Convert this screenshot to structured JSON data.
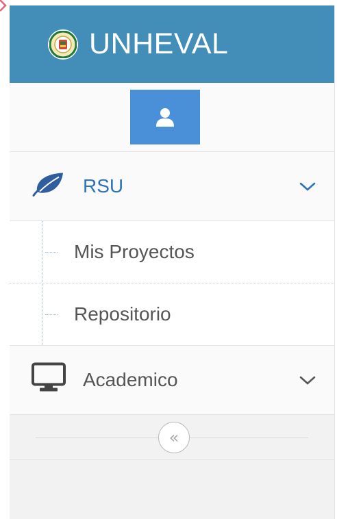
{
  "brand": {
    "title": "UNHEVAL",
    "bg_color": "#438eb9"
  },
  "shortcuts": {
    "user_icon": "user-icon",
    "button_color": "#4a90d9"
  },
  "nav": {
    "items": [
      {
        "label": "RSU",
        "icon": "leaf-icon",
        "state": "open",
        "submenu": [
          {
            "label": "Mis Proyectos"
          },
          {
            "label": "Repositorio"
          }
        ]
      },
      {
        "label": "Academico",
        "icon": "desktop-icon",
        "state": "closed"
      }
    ]
  },
  "collapse": {
    "glyph": "«"
  }
}
